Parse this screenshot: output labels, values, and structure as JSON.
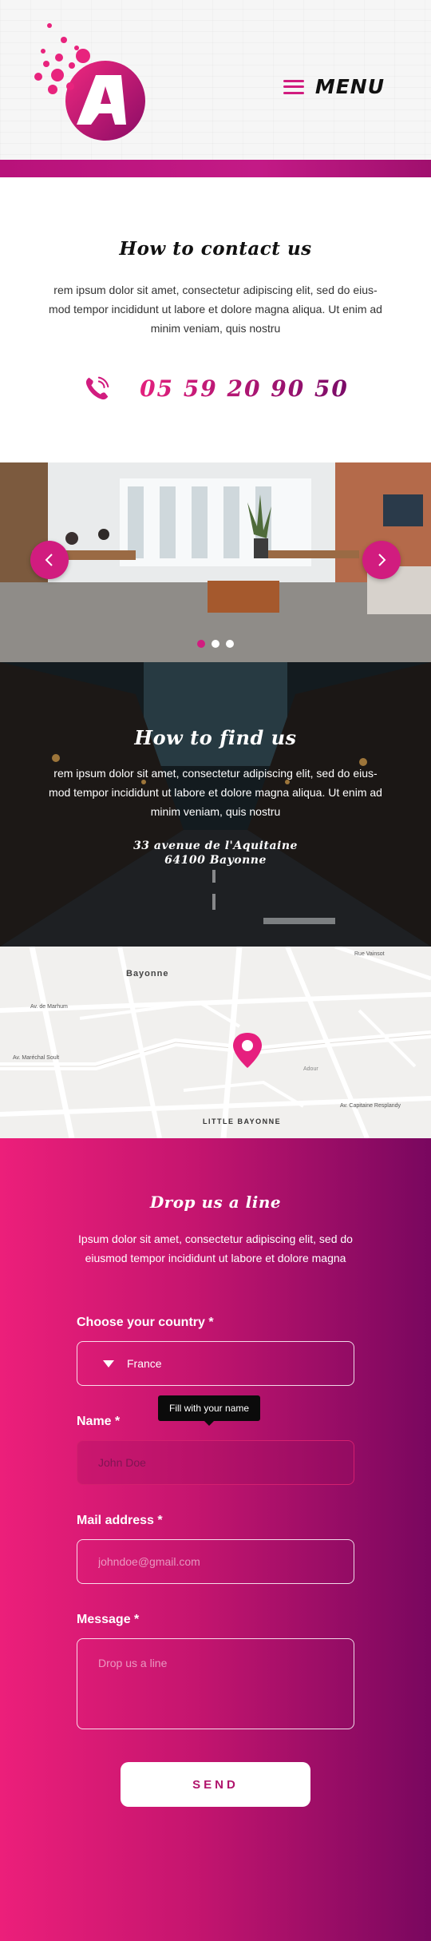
{
  "header": {
    "logo_letter": "A",
    "menu_label": "MENU"
  },
  "contact": {
    "title": "How to contact us",
    "text": "rem ipsum dolor sit amet, consectetur adipiscing elit, sed do eius- mod tempor incididunt ut labore et dolore magna aliqua. Ut enim ad minim veniam, quis nostru",
    "phone": "05 59 20 90 50"
  },
  "carousel": {
    "slides": 3,
    "active_index": 0
  },
  "find": {
    "title": "How to find us",
    "text": "rem ipsum dolor sit amet, consectetur adipiscing elit, sed do eius- mod tempor incididunt ut labore et dolore magna aliqua. Ut enim ad minim veniam, quis nostru",
    "address_line1": "33 avenue de l'Aquitaine",
    "address_line2": "64100 Bayonne"
  },
  "map": {
    "labels": {
      "city": "Bayonne",
      "district": "LITTLE BAYONNE",
      "street1": "Av. de Marhum",
      "street2": "Av. Maréchal Soult",
      "street3": "Rue Vainsot",
      "street4": "Av. Capitaine Resplandy",
      "street5": "Adour"
    }
  },
  "form": {
    "title": "Drop us a line",
    "text": "Ipsum dolor sit amet, consectetur adipiscing elit, sed do eiusmod tempor incididunt ut labore et dolore magna",
    "country_label": "Choose your country *",
    "country_value": "France",
    "name_label": "Name *",
    "name_placeholder": "John Doe",
    "name_tooltip": "Fill with your name",
    "mail_label": "Mail address *",
    "mail_placeholder": "johndoe@gmail.com",
    "message_label": "Message *",
    "message_placeholder": "Drop us a line",
    "send_label": "SEND"
  },
  "colors": {
    "accent": "#d11c7f",
    "accent_dark": "#79075f"
  }
}
